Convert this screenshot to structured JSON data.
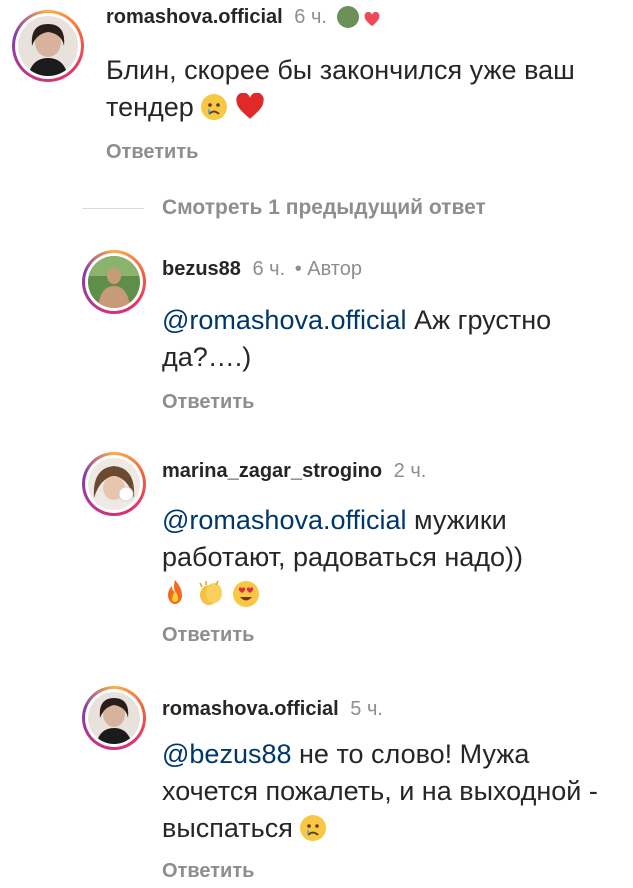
{
  "comments": [
    {
      "username": "romashova.official",
      "time": "6 ч.",
      "text": "Блин, скорее бы закончился уже ваш тендер",
      "reply": "Ответить"
    },
    {
      "username": "bezus88",
      "time": "6 ч.",
      "author_tag": "• Автор",
      "mention": "@romashova.official",
      "text": "Аж грустно да?….)",
      "reply": "Ответить"
    },
    {
      "username": "marina_zagar_strogino",
      "time": "2 ч.",
      "mention": "@romashova.official",
      "text": "мужики работают, радоваться надо))",
      "reply": "Ответить"
    },
    {
      "username": "romashova.official",
      "time": "5 ч.",
      "mention": "@bezus88",
      "text": "не то слово! Мужа хочется пожалеть, и на выходной - выспаться",
      "reply": "Ответить"
    }
  ],
  "view_replies": "Смотреть 1 предыдущий ответ",
  "icons": [
    "crying-face-emoji",
    "red-heart-emoji",
    "fire-emoji",
    "clapping-hands-emoji",
    "heart-eyes-emoji"
  ],
  "colors": {
    "mention": "#00376b",
    "secondary": "#8e8e8e",
    "heart": "#ed4956"
  }
}
